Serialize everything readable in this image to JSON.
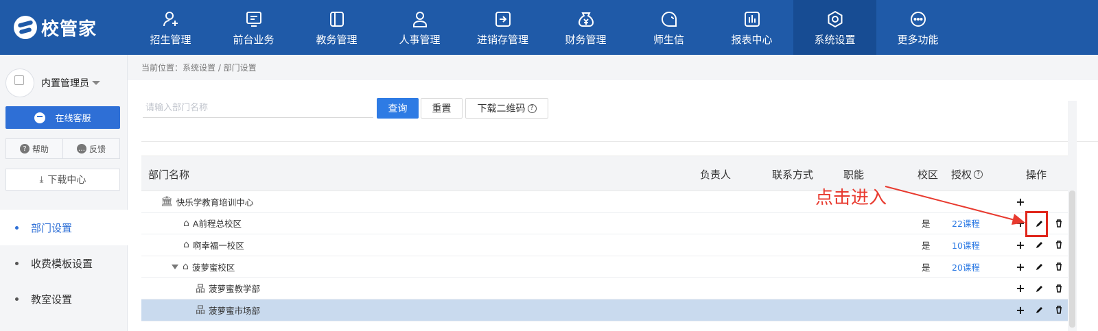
{
  "app": {
    "logo_text": "校管家"
  },
  "nav": {
    "items": [
      {
        "label": "招生管理",
        "icon": "user-plus-icon"
      },
      {
        "label": "前台业务",
        "icon": "monitor-icon"
      },
      {
        "label": "教务管理",
        "icon": "book-icon"
      },
      {
        "label": "人事管理",
        "icon": "person-icon"
      },
      {
        "label": "进销存管理",
        "icon": "inventory-icon"
      },
      {
        "label": "财务管理",
        "icon": "finance-icon"
      },
      {
        "label": "师生信",
        "icon": "chat-icon"
      },
      {
        "label": "报表中心",
        "icon": "report-icon"
      },
      {
        "label": "系统设置",
        "icon": "settings-icon",
        "active": true
      },
      {
        "label": "更多功能",
        "icon": "more-icon"
      }
    ]
  },
  "sidebar": {
    "user_name": "内置管理员",
    "service_label": "在线客服",
    "help_label": "帮助",
    "feedback_label": "反馈",
    "download_label": "下载中心",
    "menu": [
      {
        "label": "部门设置",
        "active": true
      },
      {
        "label": "收费模板设置"
      },
      {
        "label": "教室设置"
      }
    ]
  },
  "main": {
    "breadcrumb": "当前位置：系统设置 / 部门设置",
    "search_placeholder": "请输入部门名称",
    "query_label": "查询",
    "reset_label": "重置",
    "qrcode_label": "下载二维码",
    "columns": {
      "name": "部门名称",
      "manager": "负责人",
      "contact": "联系方式",
      "duty": "职能",
      "campus": "校区",
      "auth": "授权",
      "ops": "操作"
    },
    "rows": [
      {
        "name": "快乐学教育培训中心",
        "icon": "bank-icon",
        "level": 0,
        "campus": "",
        "auth": ""
      },
      {
        "name": "A前程总校区",
        "icon": "home-icon",
        "level": 1,
        "campus": "是",
        "auth": "22课程"
      },
      {
        "name": "啊幸福一校区",
        "icon": "home-icon",
        "level": 1,
        "campus": "是",
        "auth": "10课程"
      },
      {
        "name": "菠萝蜜校区",
        "icon": "home-icon",
        "level": 1,
        "campus": "是",
        "auth": "20课程",
        "expanded": true
      },
      {
        "name": "菠萝蜜教学部",
        "icon": "org-icon",
        "level": 2,
        "campus": "",
        "auth": ""
      },
      {
        "name": "菠萝蜜市场部",
        "icon": "org-icon",
        "level": 2,
        "campus": "",
        "auth": "",
        "selected": true
      }
    ]
  },
  "annotation": {
    "text": "点击进入",
    "color": "#e83a2f"
  },
  "colors": {
    "topbar": "#1f5aa8",
    "primary": "#2e7be4",
    "link": "#2e7be4"
  }
}
